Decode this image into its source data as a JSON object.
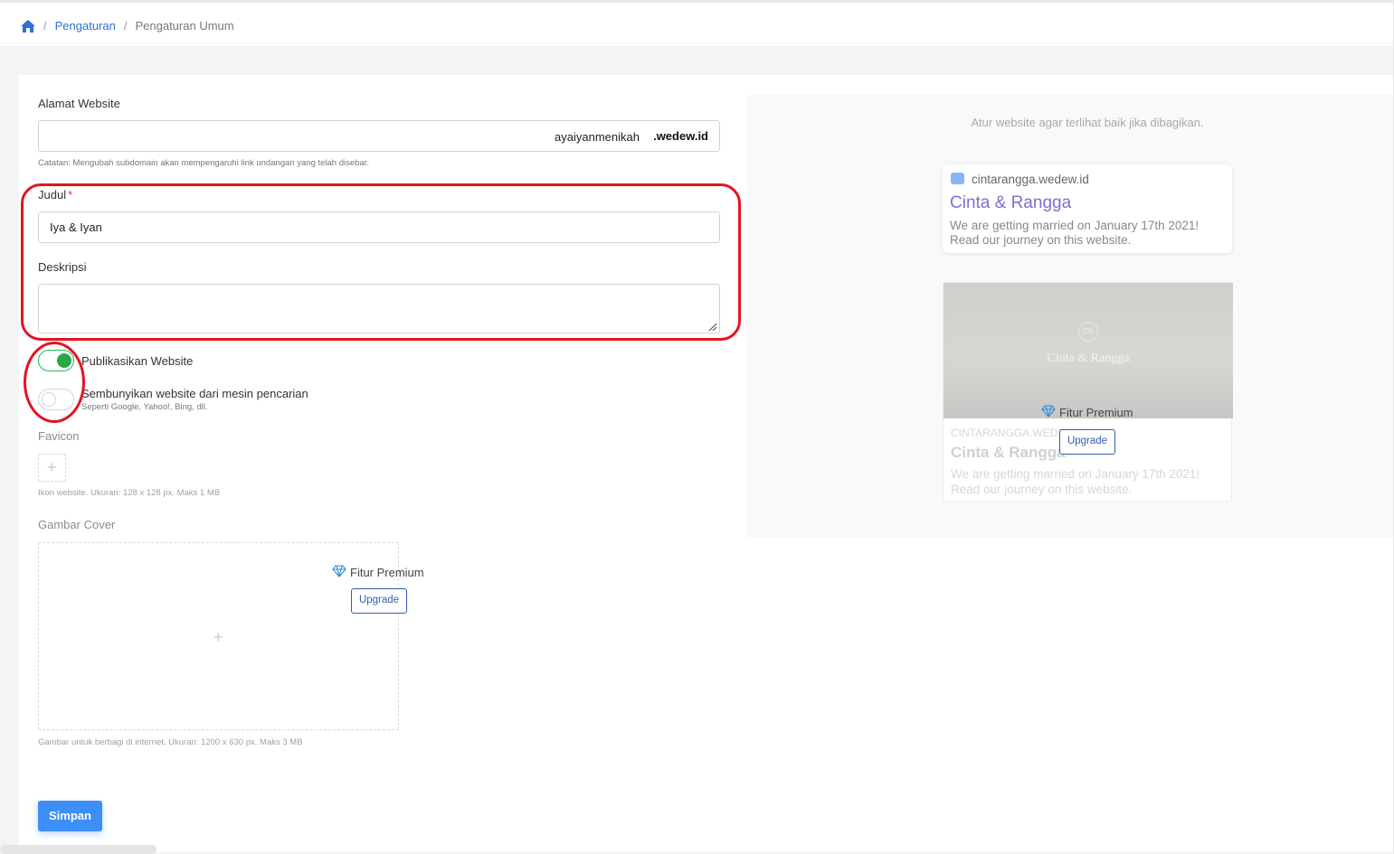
{
  "breadcrumb": {
    "home_icon": "home-icon",
    "items": [
      "Pengaturan",
      "Pengaturan Umum"
    ],
    "separator": "/"
  },
  "form": {
    "website_address": {
      "label": "Alamat Website",
      "value": "ayaiyanmenikah",
      "suffix": ".wedew.id",
      "note": "Catatan: Mengubah subdomain akan mempengaruhi link undangan yang telah disebar."
    },
    "title": {
      "label": "Judul",
      "required_mark": "*",
      "value": "Iya & Iyan"
    },
    "description": {
      "label": "Deskripsi",
      "value": ""
    },
    "publish": {
      "label": "Publikasikan Website",
      "checked": true
    },
    "hide_search": {
      "label": "Sembunyikan website dari mesin pencarian",
      "sublabel": "Seperti Google, Yahoo!, Bing, dll.",
      "checked": false
    },
    "favicon": {
      "label": "Favicon",
      "plus": "+",
      "note": "Ikon website. Ukuran: 128 x 128 px. Maks 1 MB"
    },
    "cover": {
      "label": "Gambar Cover",
      "premium_label": "Fitur Premium",
      "upgrade_label": "Upgrade",
      "plus": "+",
      "note": "Gambar untuk berbagi di internet. Ukuran: 1200 x 630 px. Maks 3 MB"
    },
    "save_label": "Simpan"
  },
  "preview": {
    "hint": "Atur website agar terlihat baik jika dibagikan.",
    "search_card": {
      "url": "cintarangga.wedew.id",
      "title": "Cinta & Rangga",
      "description": "We are getting married on January 17th 2021! Read our journey on this website."
    },
    "social_card": {
      "monogram": "CR",
      "image_title": "Cinta & Rangga",
      "domain": "CINTARANGGA.WEDEW.ID",
      "title": "Cinta & Rangga",
      "description": "We are getting married on January 17th 2021! Read our journey on this website.",
      "premium_label": "Fitur Premium",
      "upgrade_label": "Upgrade"
    }
  },
  "colors": {
    "accent": "#2f6fd6",
    "switch_on": "#28a745",
    "save_button": "#3e8ef7",
    "annotation": "#e3141f",
    "preview_title": "#7e6fcf"
  }
}
